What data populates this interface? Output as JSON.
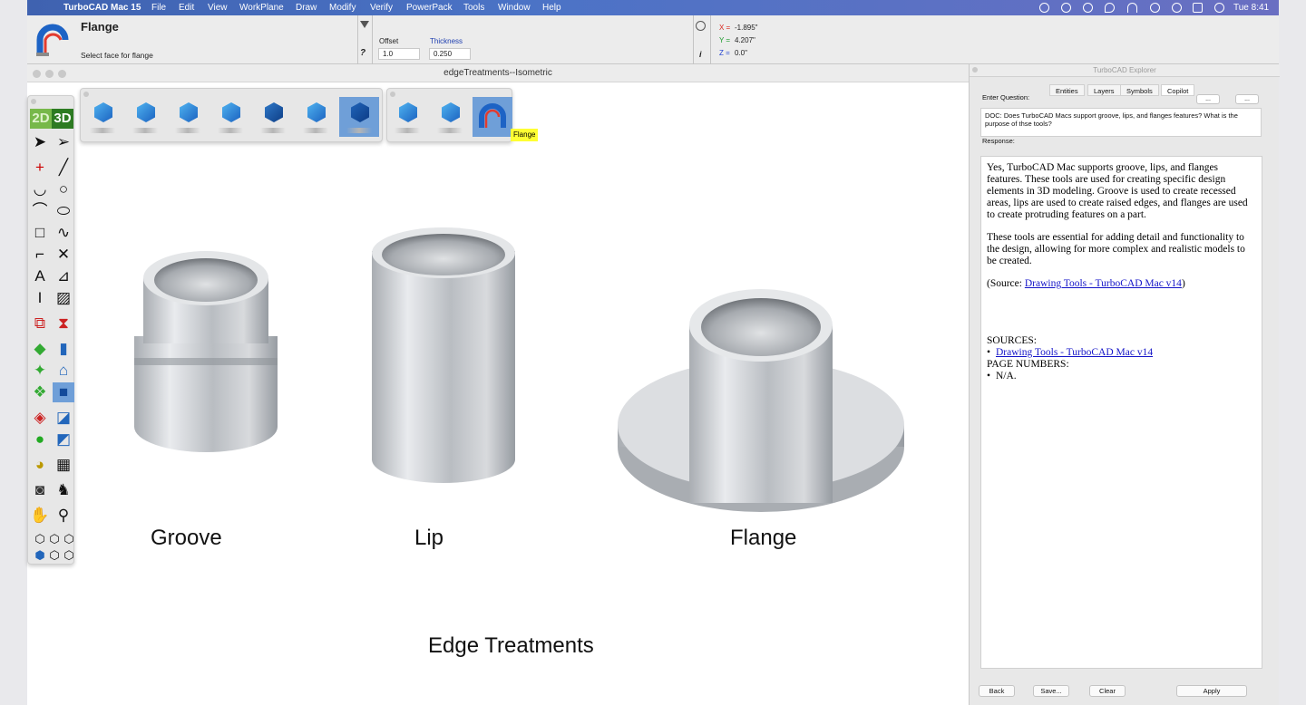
{
  "menubar": {
    "app": "TurboCAD Mac 15",
    "items": [
      "File",
      "Edit",
      "View",
      "WorkPlane",
      "Draw",
      "Modify",
      "Verify",
      "PowerPack",
      "Tools",
      "Window",
      "Help"
    ],
    "clock": "Tue 8:41"
  },
  "command": {
    "title": "Flange",
    "prompt": "Select face for flange",
    "offset_label": "Offset",
    "offset_value": "1.0",
    "thickness_label": "Thickness",
    "thickness_value": "0.250",
    "help_glyph": "?",
    "info_glyph": "i",
    "coords": {
      "x_label": "X =",
      "x": "-1.895\"",
      "y_label": "Y =",
      "y": "4.207\"",
      "z_label": "Z =",
      "z": "0.0\""
    }
  },
  "document": {
    "title": "edgeTreatments--Isometric",
    "tooltip": "Flange",
    "toggle_2d": "2D",
    "toggle_3d": "3D",
    "labels": {
      "groove": "Groove",
      "lip": "Lip",
      "flange": "Flange",
      "caption": "Edge Treatments"
    }
  },
  "explorer": {
    "title": "TurboCAD Explorer",
    "tabs": [
      "Entities",
      "Layers",
      "Symbols",
      "Copilot"
    ],
    "active_tab": "Copilot",
    "question_label": "Enter Question:",
    "select1": "...",
    "select2": "...",
    "question": "DOC: Does TurboCAD Macs support groove, lips, and flanges features? What is the purpose of thse tools?",
    "response_label": "Response:",
    "response": {
      "p1": "Yes, TurboCAD Mac supports groove, lips, and flanges features. These tools are used for creating specific design elements in 3D modeling. Groove is used to create recessed areas, lips are used to create raised edges, and flanges are used to create protruding features on a part.",
      "p2": "These tools are essential for adding detail and functionality to the design, allowing for more complex and realistic models to be created.",
      "source_prefix": "(Source: ",
      "source_link": "Drawing Tools - TurboCAD Mac v14",
      "source_suffix": ")",
      "sources_heading": "SOURCES:",
      "sources_item": "Drawing Tools - TurboCAD Mac v14",
      "pages_heading": "PAGE NUMBERS:",
      "pages_item": "N/A."
    },
    "buttons": {
      "back": "Back",
      "save": "Save...",
      "clear": "Clear",
      "apply": "Apply"
    }
  },
  "colors": {
    "accent": "#4b73c6",
    "selected_tool": "#6f9fd8",
    "tooltip": "#ffff33",
    "link": "#1515c8"
  }
}
